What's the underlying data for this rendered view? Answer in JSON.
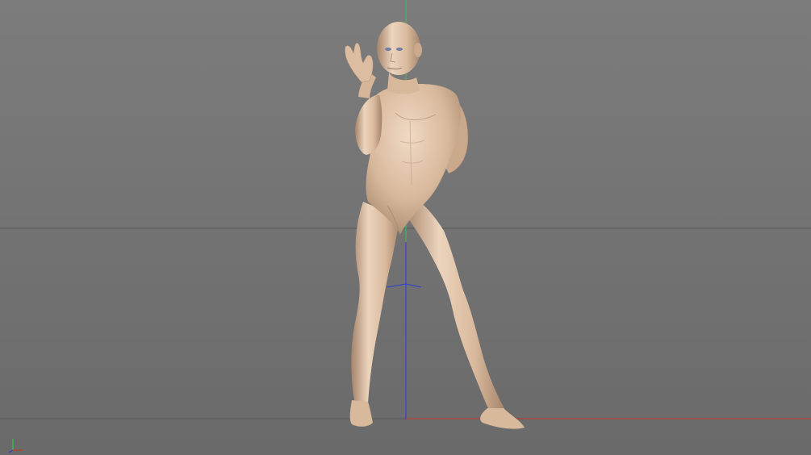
{
  "viewport": {
    "background_top": "#7c7c7c",
    "background_bottom": "#6a6a6a",
    "floor_grid_color": "#5a5a5a",
    "axis_colors": {
      "x": "#c0392b",
      "y": "#2ecc40",
      "z": "#2d3fd4"
    }
  },
  "figure": {
    "skin_light": "#ecd4bd",
    "skin_mid": "#d9b99c",
    "skin_shadow": "#a58469",
    "eye_color": "#6e7fa6"
  },
  "gizmo": {
    "icon": "orientation-axes-icon"
  }
}
